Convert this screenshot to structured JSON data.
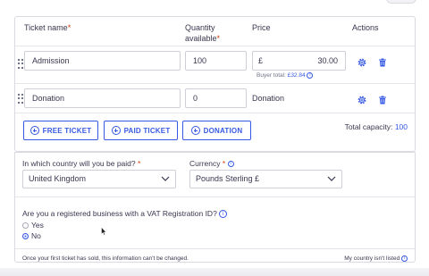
{
  "tickets": {
    "headers": {
      "name": "Ticket name",
      "name_required": "*",
      "quantity_line1": "Quantity",
      "quantity_line2": "available",
      "quantity_required": "*",
      "price": "Price",
      "actions": "Actions"
    },
    "rows": [
      {
        "name": "Admission",
        "quantity": "100",
        "price_currency": "£",
        "price_amount": "30.00",
        "buyer_total_label": "Buyer total:",
        "buyer_total_value": "£32.84",
        "settings_icon": "gear-icon",
        "delete_icon": "trash-icon"
      },
      {
        "name": "Donation",
        "quantity": "0",
        "price_text": "Donation",
        "settings_icon": "gear-icon",
        "delete_icon": "trash-icon"
      }
    ],
    "buttons": {
      "free": "FREE TICKET",
      "paid": "PAID TICKET",
      "donation": "DONATION"
    },
    "capacity_label": "Total capacity:",
    "capacity_value": "100"
  },
  "payout": {
    "country_label": "In which country will you be paid?",
    "country_required": "*",
    "country_value": "United Kingdom",
    "currency_label": "Currency",
    "currency_required": "*",
    "currency_value": "Pounds Sterling £",
    "vat_question": "Are you a registered business with a VAT Registration ID?",
    "vat_options": [
      {
        "label": "Yes",
        "selected": false
      },
      {
        "label": "No",
        "selected": true
      }
    ],
    "footer_note": "Once your first ticket has sold, this information can't be changed.",
    "not_listed_link": "My country isn't listed"
  },
  "colors": {
    "accent": "#3659e3",
    "required": "#d1410c",
    "text": "#39364f",
    "border": "#dbdae3"
  }
}
